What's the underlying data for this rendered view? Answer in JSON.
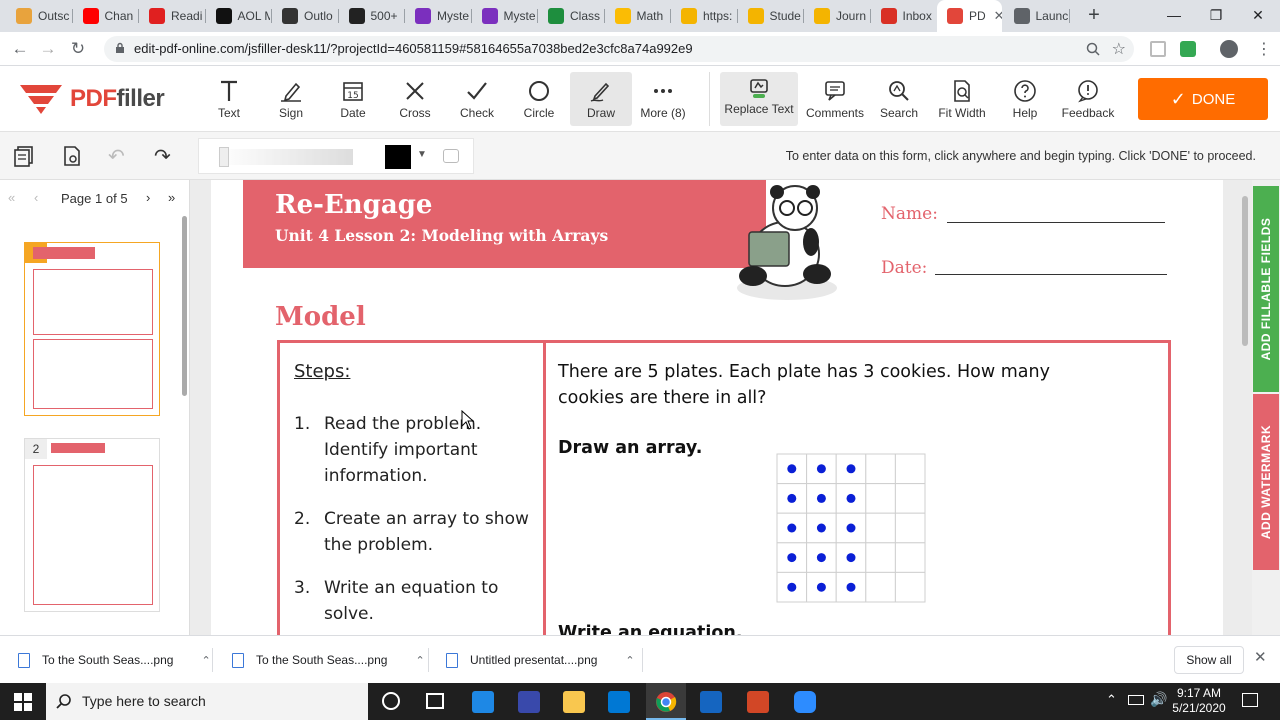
{
  "browser": {
    "tabs": [
      {
        "label": "Outsc",
        "color": "#e8a33d"
      },
      {
        "label": "Chan",
        "color": "#ff0000"
      },
      {
        "label": "Readi",
        "color": "#e02020"
      },
      {
        "label": "AOL M",
        "color": "#111111"
      },
      {
        "label": "Outlo",
        "color": "#333333"
      },
      {
        "label": "500+",
        "color": "#222222"
      },
      {
        "label": "Myste",
        "color": "#7b2fbe"
      },
      {
        "label": "Myste",
        "color": "#7b2fbe"
      },
      {
        "label": "Class",
        "color": "#1e8e3e"
      },
      {
        "label": "Math",
        "color": "#fbbc04"
      },
      {
        "label": "https:",
        "color": "#f4b400"
      },
      {
        "label": "Stude",
        "color": "#f4b400"
      },
      {
        "label": "Journ",
        "color": "#f4b400"
      },
      {
        "label": "Inbox",
        "color": "#d93025"
      },
      {
        "label": "PD",
        "color": "#e2463a",
        "active": true
      },
      {
        "label": "Launc",
        "color": "#5f6368"
      }
    ],
    "url": "edit-pdf-online.com/jsfiller-desk11/?projectId=460581159#58164655a7038bed2e3cfc8a74a992e9"
  },
  "app": {
    "logo": {
      "pdf": "PDF",
      "filler": "filler"
    },
    "tools": [
      {
        "name": "text",
        "label": "Text"
      },
      {
        "name": "sign",
        "label": "Sign"
      },
      {
        "name": "date",
        "label": "Date"
      },
      {
        "name": "cross",
        "label": "Cross"
      },
      {
        "name": "check",
        "label": "Check"
      },
      {
        "name": "circle",
        "label": "Circle"
      },
      {
        "name": "draw",
        "label": "Draw",
        "active": true
      },
      {
        "name": "more",
        "label": "More (8)"
      }
    ],
    "replace_text": "Replace Text",
    "right_tools": [
      {
        "name": "comments",
        "label": "Comments"
      },
      {
        "name": "search",
        "label": "Search"
      },
      {
        "name": "fit-width",
        "label": "Fit Width"
      },
      {
        "name": "help",
        "label": "Help"
      },
      {
        "name": "feedback",
        "label": "Feedback"
      }
    ],
    "done_label": "DONE",
    "accent": "#ff6c00",
    "hint": "To enter data on this form, click anywhere and begin typing. Click 'DONE' to proceed."
  },
  "sidebar": {
    "page_word": "Page",
    "page_current": "1",
    "page_of": "of 5",
    "thumbnails": [
      "1",
      "2"
    ]
  },
  "document": {
    "banner_title": "Re-Engage",
    "banner_subtitle": "Unit 4 Lesson 2: Modeling with Arrays",
    "name_label": "Name:",
    "date_label": "Date:",
    "section": "Model",
    "steps_title": "Steps:",
    "steps": [
      {
        "n": "1.",
        "text": "Read the problem. Identify important information."
      },
      {
        "n": "2.",
        "text": "Create an array to show the problem."
      },
      {
        "n": "3.",
        "text": "Write an equation to solve."
      }
    ],
    "problem": "There are 5 plates.  Each plate has 3 cookies.  How many cookies are there in all?",
    "draw_label": "Draw an array.",
    "equation_label": "Write an equation.",
    "array": {
      "rows": 5,
      "cols": 5,
      "filled_cols": 3,
      "dot_color": "#0a1fd6"
    }
  },
  "right_strip": {
    "fillable": "ADD FILLABLE FIELDS",
    "watermark": "ADD WATERMARK",
    "fillable_color": "#4caf50",
    "watermark_color": "#e3636c"
  },
  "downloads": {
    "items": [
      "To the South Seas....png",
      "To the South Seas....png",
      "Untitled presentat....png"
    ],
    "show_all": "Show all"
  },
  "taskbar": {
    "search_placeholder": "Type here to search",
    "time": "9:17 AM",
    "date": "5/21/2020"
  }
}
